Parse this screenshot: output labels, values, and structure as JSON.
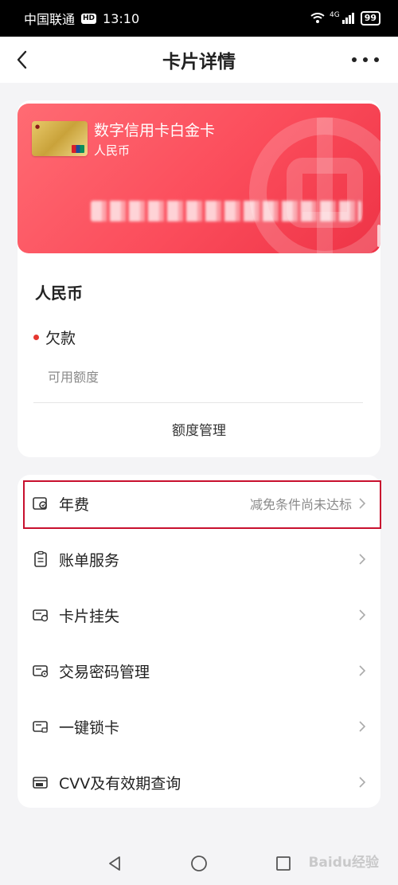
{
  "status_bar": {
    "carrier": "中国联通",
    "hd": "HD",
    "time": "13:10",
    "network": "4G",
    "battery": "99"
  },
  "header": {
    "title": "卡片详情",
    "back_icon": "chevron-left-icon",
    "more_icon": "more-horizontal-icon"
  },
  "card": {
    "name": "数字信用卡白金卡",
    "currency": "人民币",
    "number_masked": "•••• •••• •••• ••••",
    "theme_color": "#fb4c5b",
    "network_logo": "unionpay-icon"
  },
  "account": {
    "currency_title": "人民币",
    "debt_label": "欠款",
    "available_label": "可用额度",
    "limit_management": "额度管理"
  },
  "menu": [
    {
      "icon": "annual-fee-icon",
      "label": "年费",
      "extra": "减免条件尚未达标"
    },
    {
      "icon": "bill-icon",
      "label": "账单服务",
      "extra": ""
    },
    {
      "icon": "card-lost-icon",
      "label": "卡片挂失",
      "extra": ""
    },
    {
      "icon": "card-password-icon",
      "label": "交易密码管理",
      "extra": ""
    },
    {
      "icon": "card-lock-icon",
      "label": "一键锁卡",
      "extra": ""
    },
    {
      "icon": "cvv-card-icon",
      "label": "CVV及有效期查询",
      "extra": ""
    }
  ],
  "colors": {
    "accent_red": "#e5362f",
    "highlight_border": "#c8102e"
  },
  "watermark": "Baidu经验",
  "nav": {
    "back": "nav-back-icon",
    "home": "nav-home-icon",
    "recent": "nav-recent-icon"
  }
}
